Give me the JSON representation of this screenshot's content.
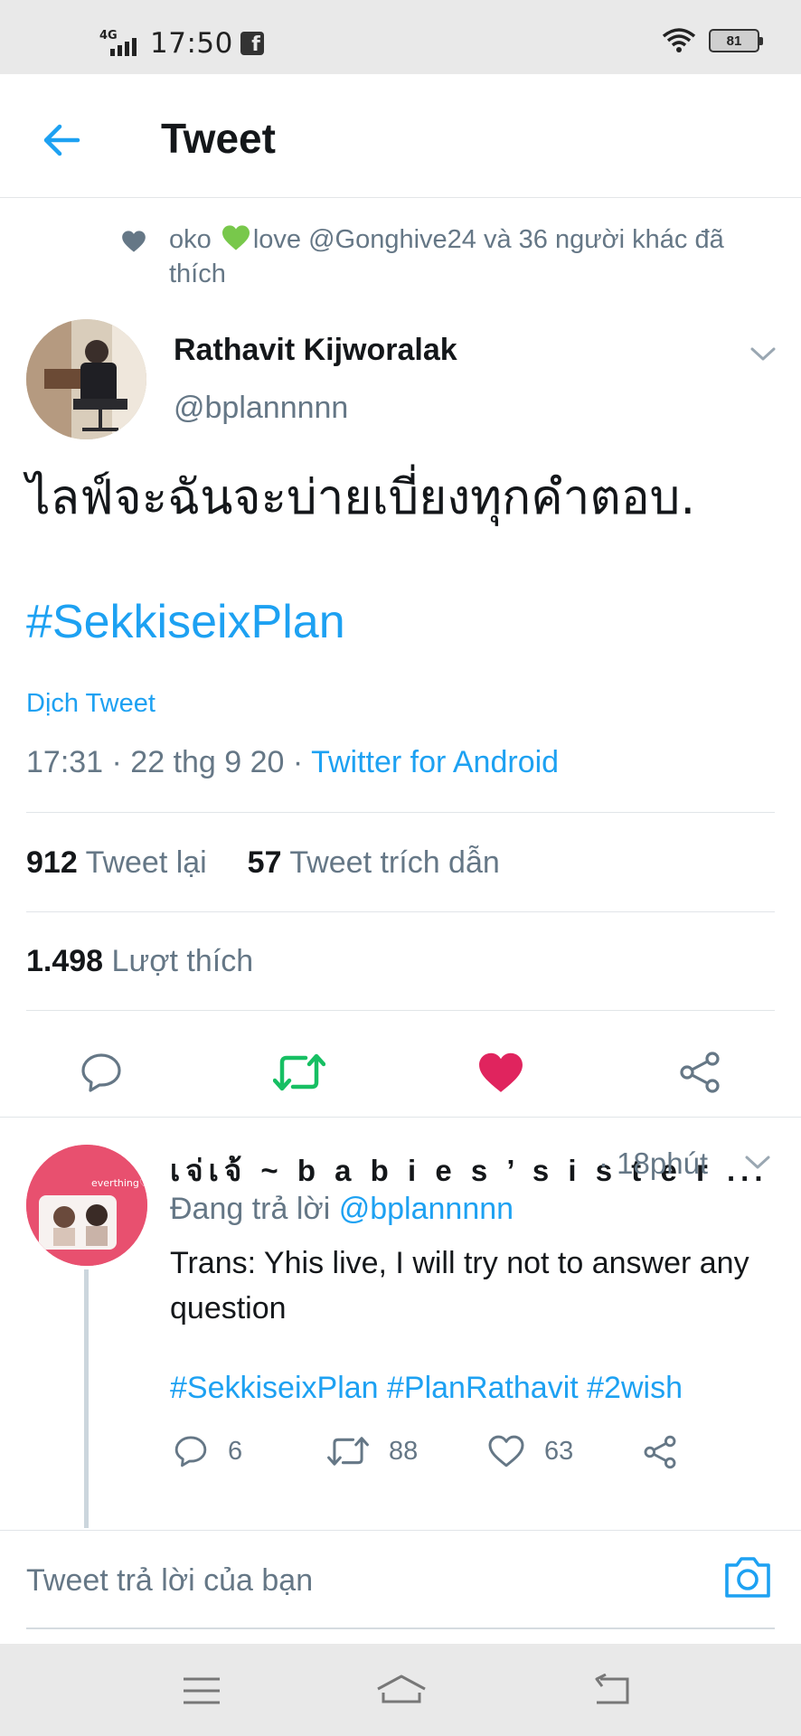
{
  "status_bar": {
    "network": "4G",
    "time": "17:50",
    "battery": "81",
    "icons": [
      "signal-icon",
      "facebook-icon",
      "wifi-icon",
      "battery-icon"
    ]
  },
  "header": {
    "title": "Tweet",
    "back_icon": "arrow-left-icon"
  },
  "liked_by": {
    "prefix": "oko ",
    "suffix": "love @Gonghive24 và 36 người khác đã thích"
  },
  "tweet": {
    "author_name": "Rathavit Kijworalak",
    "author_handle": "@bplannnnn",
    "text": "ไลฟ์จะฉันจะบ่ายเบี่ยงทุกคำตอบ.",
    "hashtag": "#SekkiseixPlan",
    "translate_label": "Dịch Tweet",
    "timestamp": "17:31 · 22 thg 9 20 · ",
    "source": "Twitter for Android",
    "retweets_count": "912",
    "retweets_label": " Tweet lại",
    "quotes_count": "57",
    "quotes_label": " Tweet trích dẫn",
    "likes_count": "1.498",
    "likes_label": " Lượt thích",
    "liked": true
  },
  "reply": {
    "author_name": "เจ่เจ้ ~ b a b i e s ’ s i s t e r ...",
    "time": "· 18phút",
    "replying_prefix": "Đang trả lời ",
    "replying_handle": "@bplannnnn",
    "text": "Trans: Yhis live, I will try not to answer any question",
    "hashtags": "#SekkiseixPlan #PlanRathavit #2wish",
    "reply_count": "6",
    "retweet_count": "88",
    "like_count": "63",
    "avatar_text": "everthing♡y"
  },
  "compose": {
    "placeholder": "Tweet trả lời của bạn"
  },
  "colors": {
    "accent": "#1da1f2",
    "retweet_green": "#17bf63",
    "like_pink": "#e0245e",
    "muted": "#657786"
  }
}
